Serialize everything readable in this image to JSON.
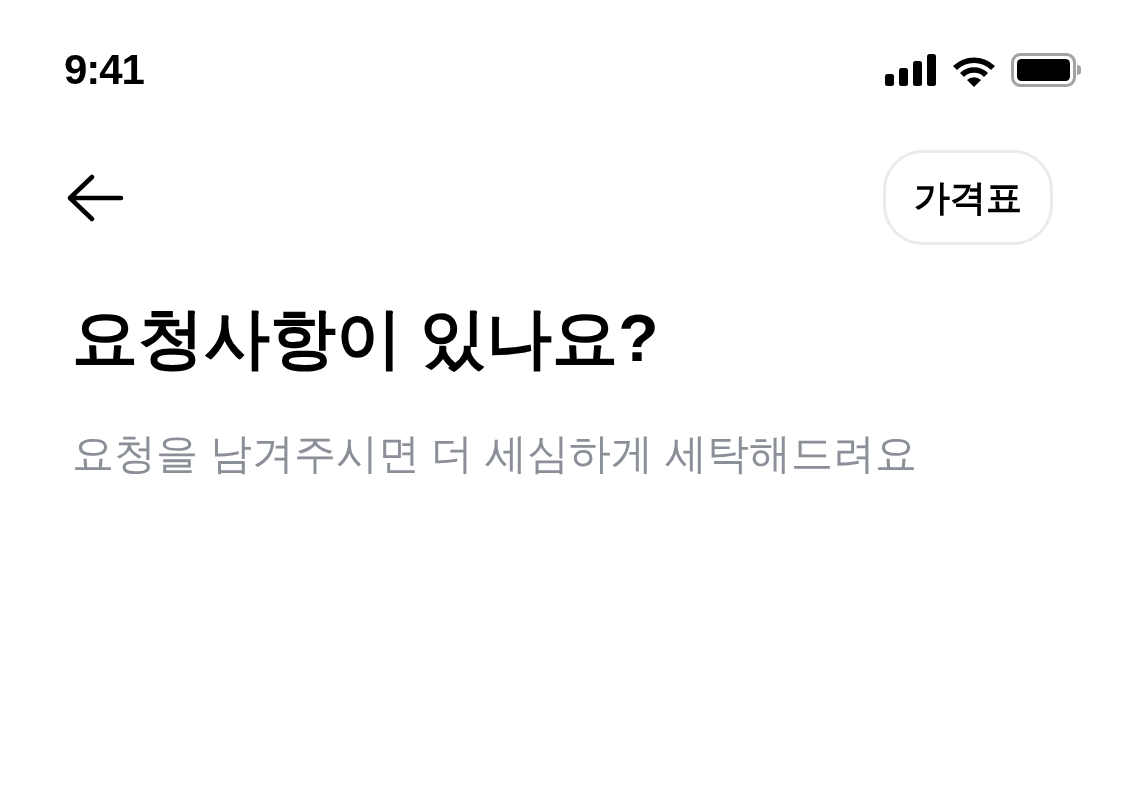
{
  "status_bar": {
    "time": "9:41"
  },
  "header": {
    "action_button": {
      "label": "가격표"
    }
  },
  "title": "요청사항이 있나요?",
  "subtitle": "요청을 남겨주시면 더 세심하게 세탁해드려요"
}
